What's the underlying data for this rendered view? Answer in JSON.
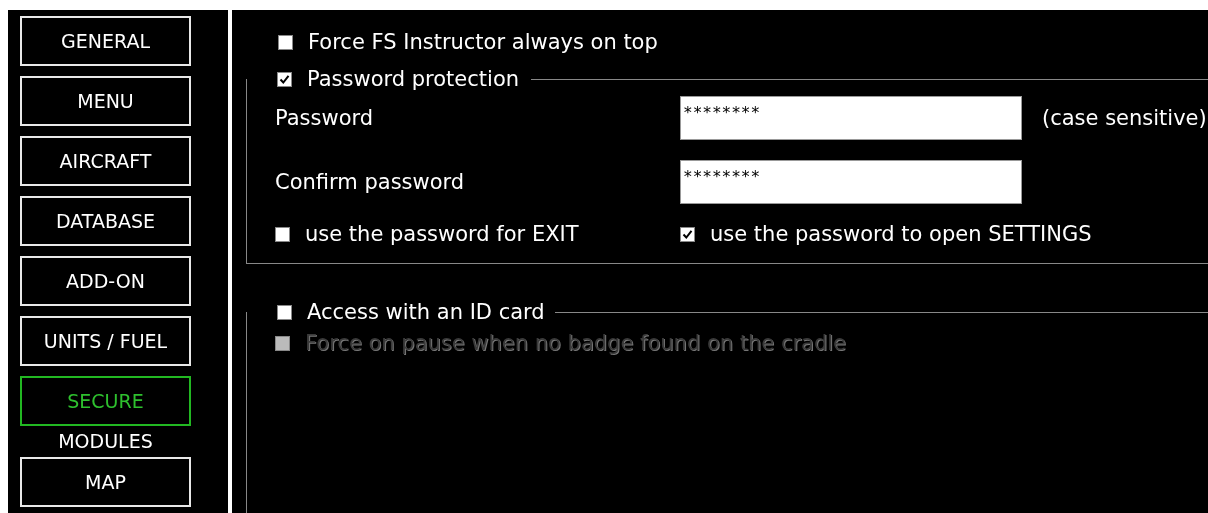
{
  "sidebar": {
    "items": [
      {
        "kind": "button",
        "label": "GENERAL",
        "selected": false
      },
      {
        "kind": "button",
        "label": "MENU",
        "selected": false
      },
      {
        "kind": "button",
        "label": "AIRCRAFT",
        "selected": false
      },
      {
        "kind": "button",
        "label": "DATABASE",
        "selected": false
      },
      {
        "kind": "button",
        "label": "ADD-ON",
        "selected": false
      },
      {
        "kind": "button",
        "label": "UNITS / FUEL",
        "selected": false
      },
      {
        "kind": "button",
        "label": "SECURE",
        "selected": true
      },
      {
        "kind": "heading",
        "label": "MODULES"
      },
      {
        "kind": "button",
        "label": "MAP",
        "selected": false
      }
    ]
  },
  "always_on_top": {
    "label": "Force FS Instructor always on top",
    "checked": false
  },
  "password_group": {
    "label": "Password protection",
    "checked": true,
    "fields": [
      {
        "label": "Password",
        "value": "********",
        "note": "(case sensitive)"
      },
      {
        "label": "Confirm password",
        "value": "********"
      }
    ],
    "options": [
      {
        "label": "use the password for EXIT",
        "checked": false
      },
      {
        "label": "use the password to open SETTINGS",
        "checked": true
      }
    ]
  },
  "id_card_group": {
    "label": "Access with an ID card",
    "checked": false,
    "options": [
      {
        "label": "Force on pause when no badge found on the cradle",
        "checked": false,
        "disabled": true
      }
    ]
  }
}
